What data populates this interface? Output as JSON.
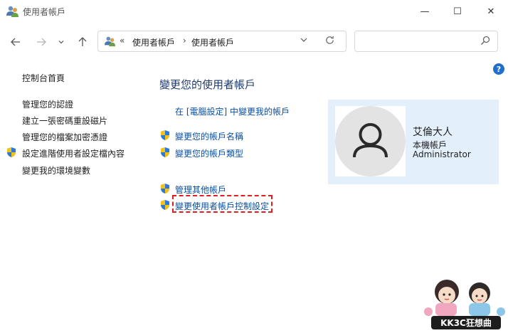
{
  "window": {
    "title": "使用者帳戶",
    "minimize": "—",
    "maximize": "☐",
    "close": "✕"
  },
  "address": {
    "chevron": "«",
    "crumbs": [
      "使用者帳戶",
      "使用者帳戶"
    ],
    "separator": "›"
  },
  "search": {
    "placeholder": "",
    "value": ""
  },
  "help": "?",
  "left_nav": {
    "home": "控制台首頁",
    "items": [
      "管理您的認證",
      "建立一張密碼重設磁片",
      "管理您的檔案加密憑證",
      "設定進階使用者設定檔內容",
      "變更我的環境變數"
    ]
  },
  "main": {
    "title": "變更您的使用者帳戶",
    "links": [
      "在 [電腦設定] 中變更我的帳戶",
      "變更您的帳戶名稱",
      "變更您的帳戶類型",
      "管理其他帳戶",
      "變更使用者帳戶控制設定"
    ]
  },
  "account": {
    "name": "艾倫大人",
    "type": "本機帳戶",
    "role": "Administrator"
  },
  "watermark": {
    "text": "KK3C狂想曲"
  },
  "colors": {
    "link": "#0a4fa0",
    "title": "#1e3a6e",
    "card": "#e3f0fb",
    "highlight": "#e02020",
    "help": "#1f6fcb"
  }
}
